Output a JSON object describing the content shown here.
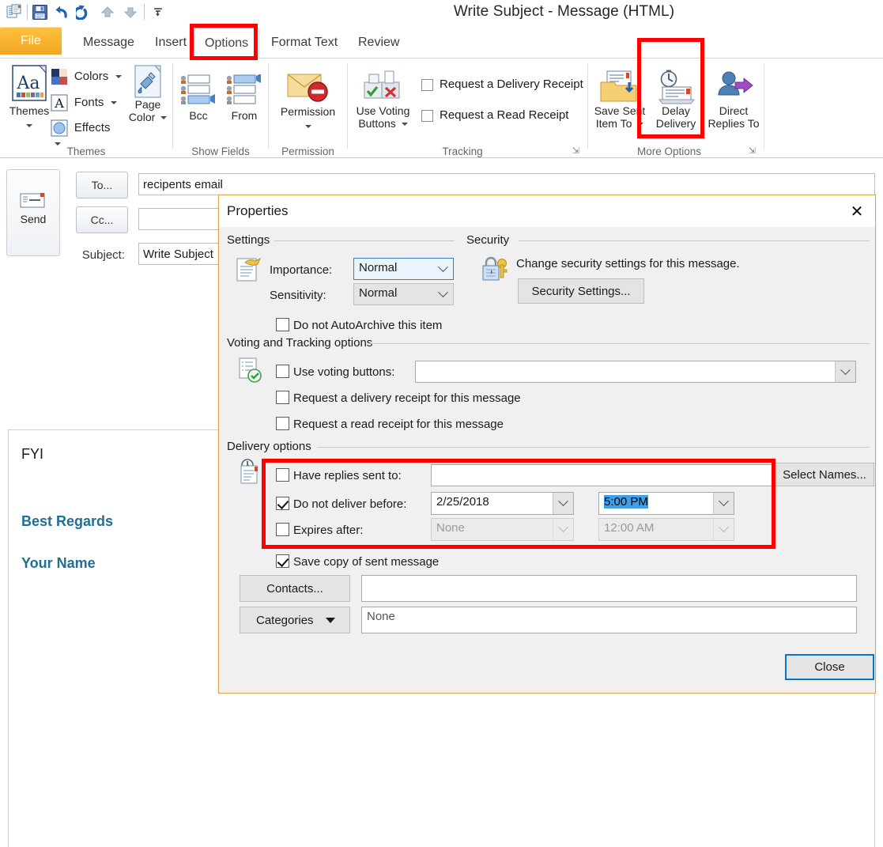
{
  "window": {
    "title": "Write Subject  -  Message (HTML)"
  },
  "quick_access": {
    "items": [
      {
        "name": "new-message-icon",
        "label": "New Message"
      },
      {
        "name": "save-icon",
        "label": "Save"
      },
      {
        "name": "undo-icon",
        "label": "Undo"
      },
      {
        "name": "redo-icon",
        "label": "Redo"
      },
      {
        "name": "previous-item-icon",
        "label": "Previous Item"
      },
      {
        "name": "next-item-icon",
        "label": "Next Item"
      },
      {
        "name": "customize-qat-icon",
        "label": "Customize Quick Access Toolbar"
      }
    ]
  },
  "tabs": [
    {
      "label": "File",
      "active": false,
      "style": "file"
    },
    {
      "label": "Message",
      "active": false
    },
    {
      "label": "Insert",
      "active": false
    },
    {
      "label": "Options",
      "active": true
    },
    {
      "label": "Format Text",
      "active": false
    },
    {
      "label": "Review",
      "active": false
    }
  ],
  "ribbon": {
    "groups": [
      {
        "label": "Themes"
      },
      {
        "label": "Show Fields"
      },
      {
        "label": "Permission"
      },
      {
        "label": "Tracking"
      },
      {
        "label": "More Options"
      }
    ],
    "themes": {
      "themes_button": "Themes",
      "colors": "Colors",
      "fonts": "Fonts",
      "effects": "Effects",
      "page_color_line1": "Page",
      "page_color_line2": "Color"
    },
    "show_fields": {
      "bcc": "Bcc",
      "from": "From"
    },
    "permission": {
      "permission": "Permission"
    },
    "tracking": {
      "use_voting_line1": "Use Voting",
      "use_voting_line2": "Buttons",
      "request_delivery_receipt": "Request a Delivery Receipt",
      "request_read_receipt": "Request a Read Receipt"
    },
    "more_options": {
      "save_sent_line1": "Save Sent",
      "save_sent_line2": "Item To",
      "delay_line1": "Delay",
      "delay_line2": "Delivery",
      "direct_line1": "Direct",
      "direct_line2": "Replies To"
    }
  },
  "compose": {
    "send_button": "Send",
    "to_button": "To...",
    "cc_button": "Cc...",
    "subject_label": "Subject:",
    "to_value": "recipents email",
    "cc_value": "",
    "subject_value": "Write Subject",
    "body": {
      "line1": "FYI",
      "line2": "Best Regards",
      "line3": "Your Name",
      "signature_color": "#1f6f94"
    }
  },
  "dialog": {
    "title": "Properties",
    "close_icon": "✕",
    "settings": {
      "group_label": "Settings",
      "importance_label": "Importance:",
      "importance_value": "Normal",
      "sensitivity_label": "Sensitivity:",
      "sensitivity_value": "Normal",
      "autoarchive_label": "Do not AutoArchive this item",
      "autoarchive_checked": false
    },
    "security": {
      "group_label": "Security",
      "description": "Change security settings for this message.",
      "button_label": "Security Settings..."
    },
    "voting_tracking": {
      "group_label": "Voting and Tracking options",
      "use_voting_label": "Use voting buttons:",
      "use_voting_checked": false,
      "use_voting_value": "",
      "delivery_receipt_label": "Request a delivery receipt for this message",
      "delivery_receipt_checked": false,
      "read_receipt_label": "Request a read receipt for this message",
      "read_receipt_checked": false
    },
    "delivery": {
      "group_label": "Delivery options",
      "have_replies_label": "Have replies sent to:",
      "have_replies_checked": false,
      "have_replies_value": "",
      "select_names_button": "Select Names...",
      "not_deliver_label": "Do not deliver before:",
      "not_deliver_checked": true,
      "not_deliver_date": "2/25/2018",
      "not_deliver_time": "5:00 PM",
      "expires_label": "Expires after:",
      "expires_checked": false,
      "expires_date": "None",
      "expires_time": "12:00 AM",
      "save_copy_label": "Save copy of sent message",
      "save_copy_checked": true
    },
    "footer": {
      "contacts_button": "Contacts...",
      "contacts_value": "",
      "categories_button": "Categories",
      "categories_value": "None",
      "close_button": "Close"
    }
  },
  "annotations": {
    "highlight_color": "#ff0000",
    "boxes": [
      {
        "name": "options-tab-highlight"
      },
      {
        "name": "delay-delivery-highlight"
      },
      {
        "name": "delivery-options-highlight"
      }
    ]
  }
}
